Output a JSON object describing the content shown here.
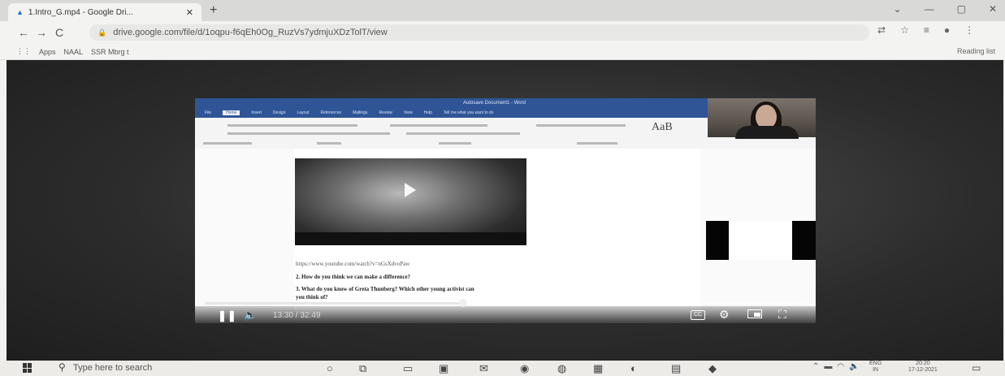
{
  "browser": {
    "tab_title": "1.Intro_G.mp4 - Google Dri...",
    "tab_close": "✕",
    "new_tab": "+",
    "window_controls": [
      "⌄",
      "—",
      "▢",
      "✕"
    ],
    "back": "←",
    "forward": "→",
    "reload": "C",
    "url": "drive.google.com/file/d/1oqpu-f6qEh0Og_RuzVs7ydmjuXDzTolT/view",
    "bookmarks": [
      "Apps",
      "NAAL",
      "SSR Mbrg t"
    ],
    "reading_list": "Reading list"
  },
  "word": {
    "title": "Autosave  Document1  -  Word",
    "tell_me": "Tell me what you want to do",
    "tabs": [
      "File",
      "Home",
      "Insert",
      "Design",
      "Layout",
      "References",
      "Mailings",
      "Review",
      "View",
      "Help"
    ],
    "style_sample": "AaB"
  },
  "document": {
    "link": "https://www.youtube.com/watch?v=nGsXdvoPaw",
    "question2": "2.   How do you think we can make a difference?",
    "question3_line1": "3.  What do you know of Greta Thunberg? Which other young activist can",
    "question3_line2": "you think of?"
  },
  "player": {
    "progress_fraction": 0.43,
    "time": "13:30 / 32:49",
    "pause_icon": "❚❚",
    "volume_icon": "🔈",
    "gear_icon": "⚙",
    "fullscreen_icon": "⛶",
    "cc_label": "CC"
  },
  "taskbar": {
    "search_placeholder": "Type here to search",
    "language_line1": "ENG",
    "language_line2": "IN",
    "time": "20:20",
    "date": "17-12-2021",
    "icons": [
      "task-view-icon",
      "file-explorer-icon",
      "store-icon",
      "mail-icon",
      "chrome-icon",
      "edge-icon",
      "settings-icon",
      "word-icon",
      "photos-icon"
    ]
  }
}
